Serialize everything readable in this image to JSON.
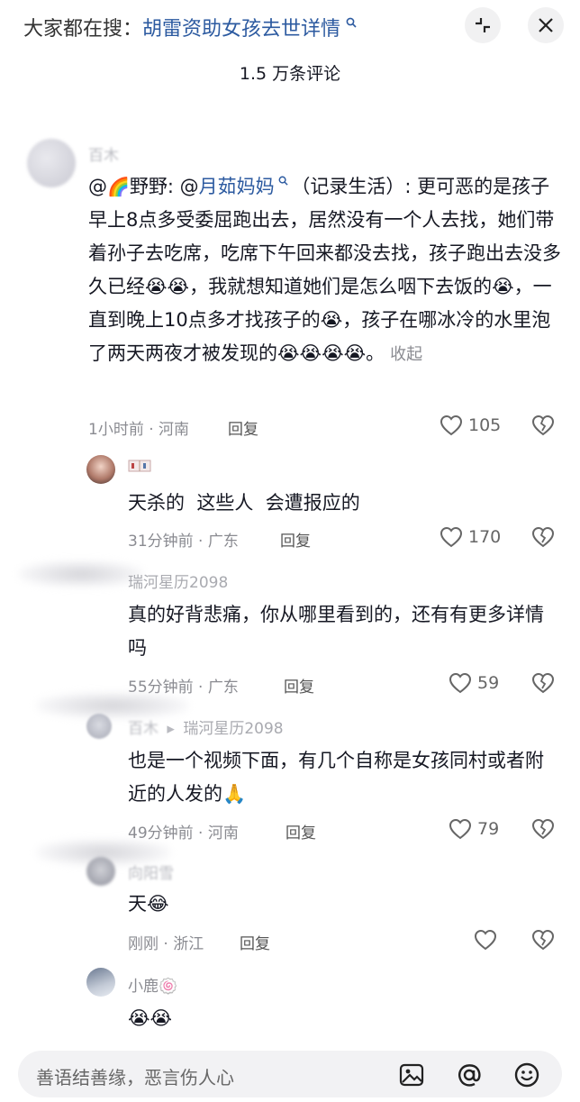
{
  "search_hint": {
    "prefix": "大家都在搜：",
    "term": "胡雷资助女孩去世详情"
  },
  "header": {
    "comment_count": "1.5 万条评论"
  },
  "comments": [
    {
      "name": "百木",
      "text_prefix": "@",
      "text_prefix_emoji": "🌈",
      "text_name": "野野: @",
      "text_mention": "月茹妈妈",
      "text_rest": "（记录生活）: 更可恶的是孩子早上8点多受委屈跑出去，居然没有一个人去找，她们带着孙子去吃席，吃席下午回来都没去找，孩子跑出去没多久已经😭😭，我就想知道她们是怎么咽下去饭的😭，一直到晚上10点多才找孩子的😭，孩子在哪冰冷的水里泡了两天两夜才被发现的😭😭😭😭。",
      "collapse": "收起",
      "meta": "1小时前 · 河南",
      "reply": "回复",
      "likes": "105"
    },
    {
      "name": "",
      "text": "天杀的  这些人  会遭报应的",
      "meta": "31分钟前 · 广东",
      "reply": "回复",
      "likes": "170"
    },
    {
      "name": "瑞河星历2098",
      "text": "真的好背悲痛，你从哪里看到的，还有有更多详情吗",
      "meta": "55分钟前 · 广东",
      "reply": "回复",
      "likes": "59"
    },
    {
      "name_blur": "百木",
      "name": "瑞河星历2098",
      "text": "也是一个视频下面，有几个自称是女孩同村或者附近的人发的🙏",
      "meta": "49分钟前 · 河南",
      "reply": "回复",
      "likes": "79"
    },
    {
      "name": "向阳雪",
      "text": "天😂",
      "meta": "刚刚 · 浙江",
      "reply": "回复",
      "likes": ""
    },
    {
      "name": "小鹿🍥",
      "text": "😭😭"
    }
  ],
  "input": {
    "placeholder": "善语结善缘，恶言伤人心"
  },
  "icons": [
    "magnifier-icon",
    "collapse-icon",
    "close-icon",
    "heart-icon",
    "broken-heart-icon",
    "image-icon",
    "at-icon",
    "emoji-icon"
  ]
}
